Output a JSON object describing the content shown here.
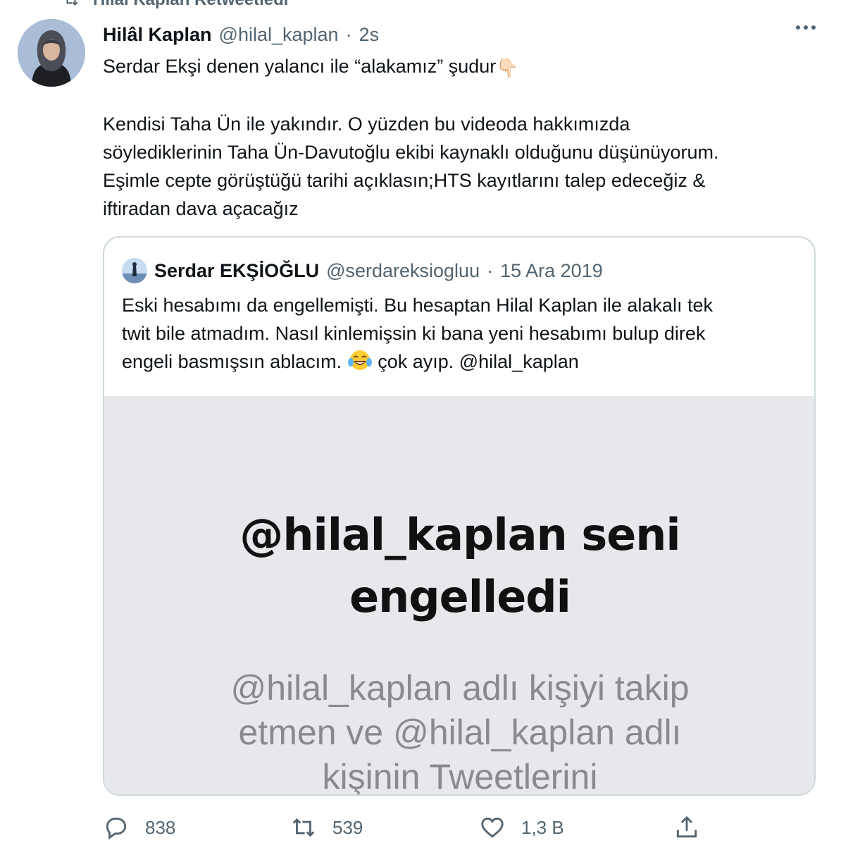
{
  "retweet_banner": {
    "text": "Hilâl Kaplan Retweetledi"
  },
  "tweet": {
    "author_name": "Hilâl Kaplan",
    "handle": "@hilal_kaplan",
    "separator": "·",
    "time": "2s",
    "lines": [
      "Serdar Ekşi denen yalancı ile “alakamız” şudur",
      "Kendisi Taha Ün ile yakındır. O yüzden bu videoda hakkımızda",
      "söylediklerinin Taha Ün-Davutoğlu ekibi kaynaklı olduğunu düşünüyorum.",
      "Eşimle cepte görüştüğü tarihi açıklasın;HTS kayıtlarını talep edeceğiz &",
      "iftiradan dava açacağız"
    ],
    "emoji_first_line": "👇🏻"
  },
  "quote": {
    "author_name": "Serdar EKŞİOĞLU",
    "handle": "@serdareksiogluu",
    "separator": "·",
    "date": "15 Ara 2019",
    "lines": [
      "Eski hesabımı da engellemişti. Bu hesaptan Hilal Kaplan ile alakalı tek",
      "twit bile atmadım. Nasıl kinlemişsin ki bana yeni hesabımı bulup direk"
    ],
    "last_line_start": "engeli basmışsın ablacım.",
    "last_line_end": "çok ayıp. @hilal_kaplan",
    "media": {
      "headline_1": "@hilal_kaplan seni",
      "headline_2": "engelledi",
      "sub_1": "@hilal_kaplan adlı kişiyi takip",
      "sub_2": "etmen ve @hilal_kaplan adlı",
      "sub_3": "kişinin Tweetlerini"
    }
  },
  "actions": {
    "reply_count": "838",
    "retweet_count": "539",
    "like_count": "1,3 B"
  },
  "colors": {
    "text": "#0f1419",
    "secondary": "#536471",
    "border": "#cfd9de",
    "media_bg": "#e7e8ec"
  }
}
